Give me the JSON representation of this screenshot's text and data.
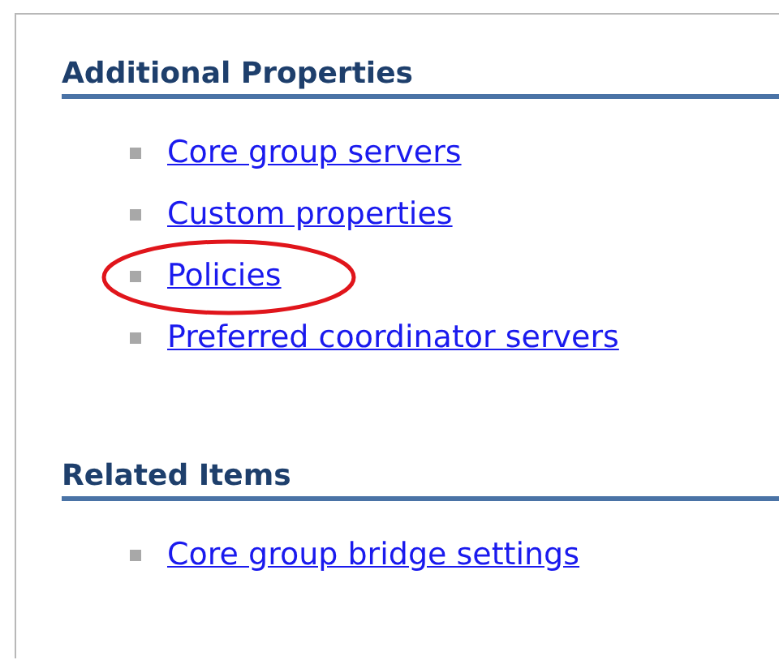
{
  "sections": [
    {
      "heading": "Additional Properties",
      "items": [
        {
          "label": "Core group servers",
          "circled": false
        },
        {
          "label": "Custom properties",
          "circled": false
        },
        {
          "label": "Policies",
          "circled": true
        },
        {
          "label": "Preferred coordinator servers",
          "circled": false
        }
      ]
    },
    {
      "heading": "Related Items",
      "items": [
        {
          "label": "Core group bridge settings",
          "circled": false
        }
      ]
    }
  ]
}
